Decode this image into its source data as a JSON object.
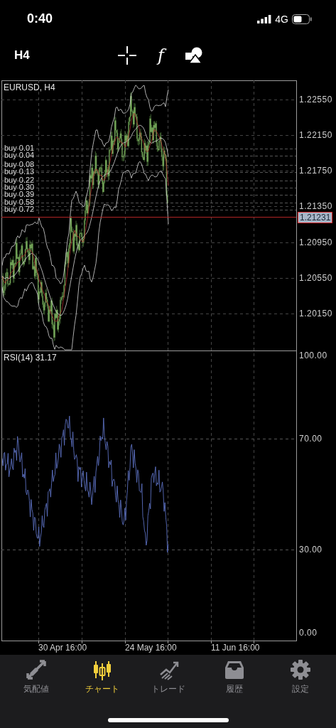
{
  "status_bar": {
    "time": "0:40",
    "network": "4G"
  },
  "toolbar": {
    "timeframe": "H4",
    "function_symbol": "f"
  },
  "chart": {
    "title": "EURUSD, H4",
    "price_axis": [
      "1.22550",
      "1.22150",
      "1.21750",
      "1.21350",
      "1.20950",
      "1.20550",
      "1.20150"
    ],
    "current_price": "1.21231",
    "orders": [
      {
        "label": "buy 0.01"
      },
      {
        "label": "buy 0.04"
      },
      {
        "label": "buy 0.08"
      },
      {
        "label": "buy 0.13"
      },
      {
        "label": "buy 0.22"
      },
      {
        "label": "buy 0.30"
      },
      {
        "label": "buy 0.39"
      },
      {
        "label": "buy 0.58"
      },
      {
        "label": "buy 0.72"
      }
    ],
    "indicator": {
      "title": "RSI(14) 31.17",
      "axis": [
        "100.00",
        "70.00",
        "30.00",
        "0.00"
      ]
    },
    "time_axis": [
      "30 Apr 16:00",
      "24 May 16:00",
      "11 Jun 16:00"
    ]
  },
  "tabs": [
    {
      "label": "気配値",
      "selected": false
    },
    {
      "label": "チャート",
      "selected": true
    },
    {
      "label": "トレード",
      "selected": false
    },
    {
      "label": "履歴",
      "selected": false
    },
    {
      "label": "設定",
      "selected": false
    }
  ]
}
